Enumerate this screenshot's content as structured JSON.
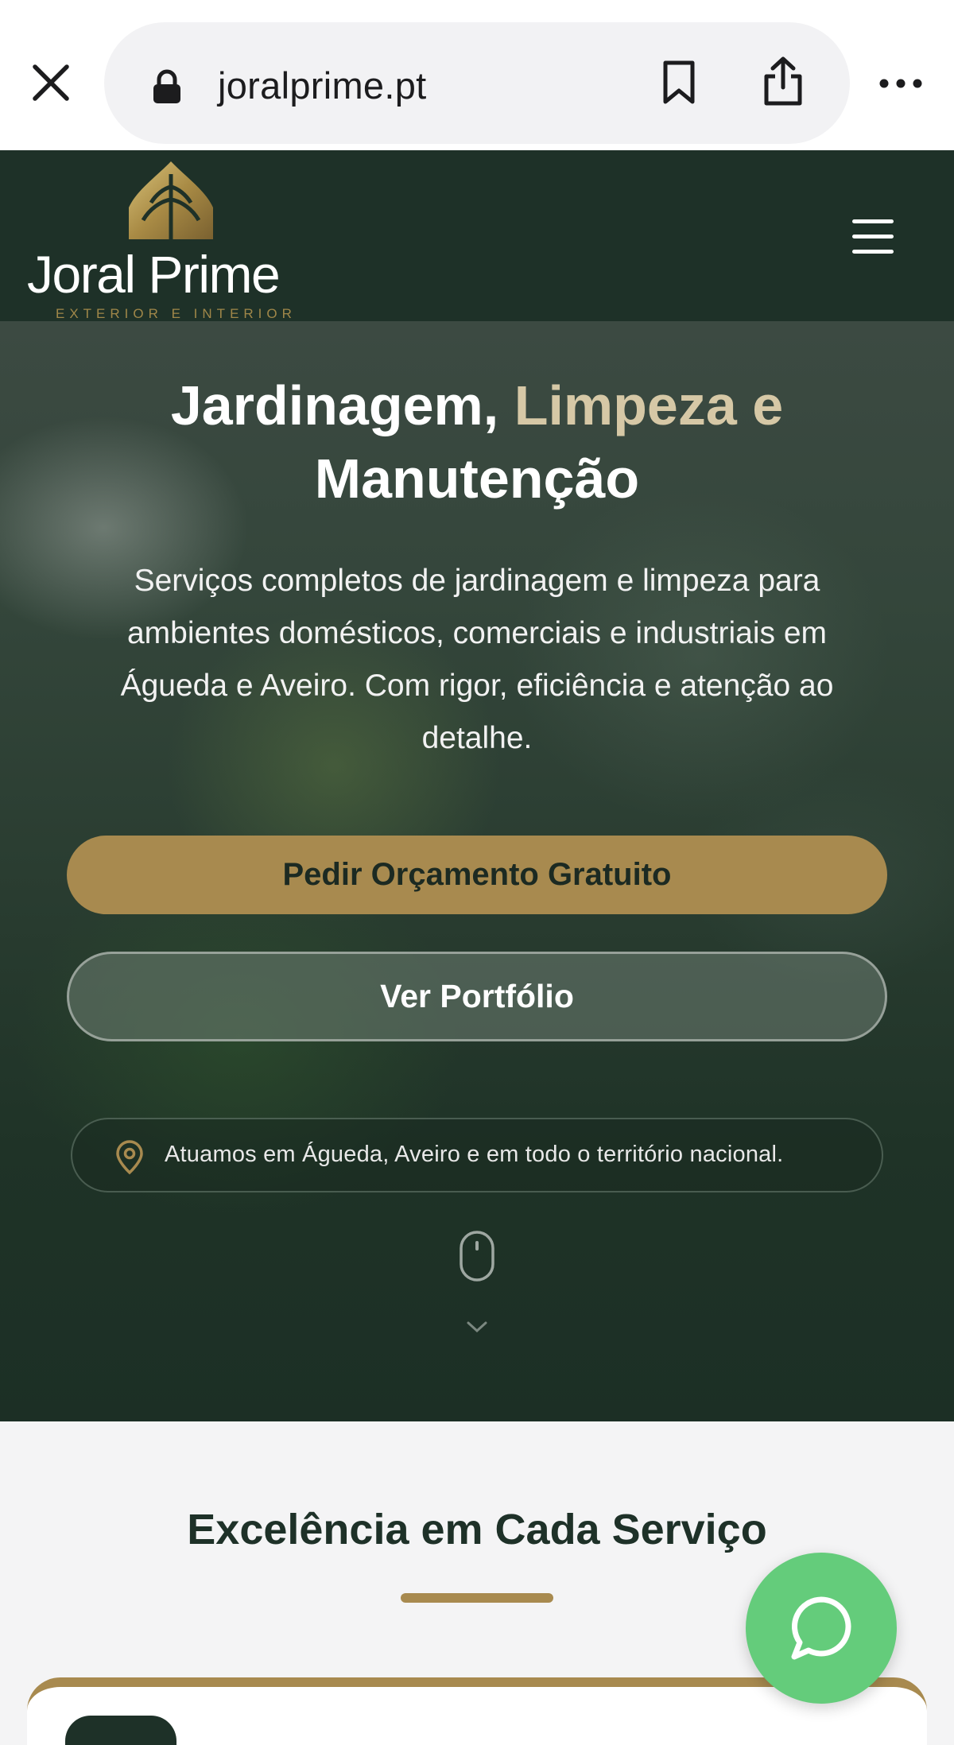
{
  "browser": {
    "url": "joralprime.pt",
    "icons": [
      "close-icon",
      "lock-icon",
      "bookmark-icon",
      "share-icon",
      "more-icon"
    ]
  },
  "header": {
    "logo_name": "Joral Prime",
    "logo_tagline": "EXTERIOR E INTERIOR",
    "menu_icon": "hamburger-icon"
  },
  "hero": {
    "title_part1": "Jardinagem,",
    "title_part2": "Limpeza e",
    "title_part3": "Manutenção",
    "subtitle": "Serviços completos de jardinagem e limpeza para ambientes domésticos, comerciais e industriais em Águeda e Aveiro. Com rigor, eficiência e atenção ao detalhe.",
    "primary_button": "Pedir Orçamento Gratuito",
    "secondary_button": "Ver Portfólio",
    "location_text": "Atuamos em Águeda, Aveiro e em todo o território nacional."
  },
  "section": {
    "title": "Excelência em Cada Serviço"
  },
  "colors": {
    "brand_green": "#1e3128",
    "accent_gold": "#a88a4f",
    "whatsapp_green": "#64cc7b"
  }
}
